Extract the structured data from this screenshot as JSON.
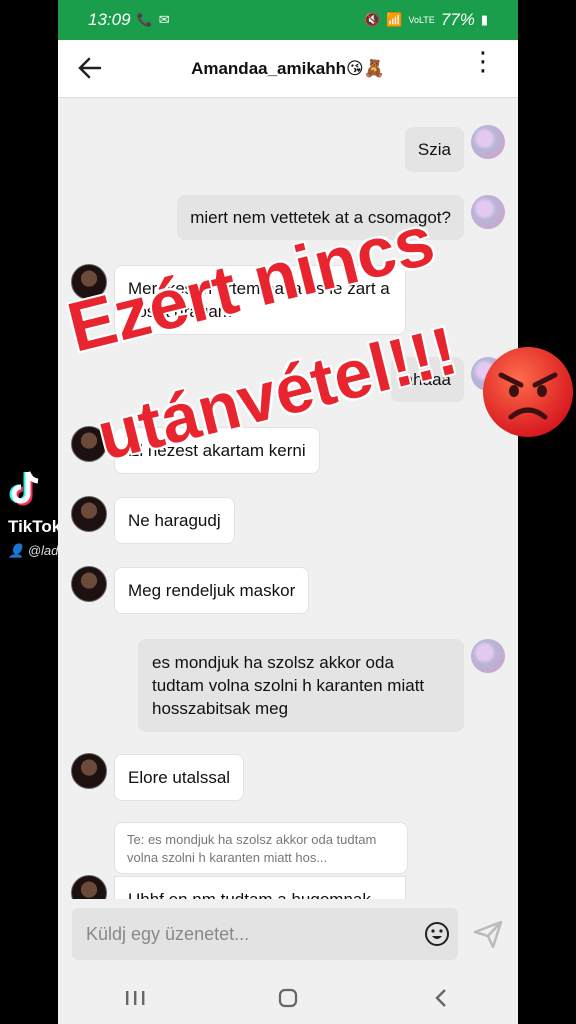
{
  "status_bar": {
    "time": "13:09",
    "battery": "77%",
    "network": "VoLTE"
  },
  "header": {
    "title": "Amandaa_amikahh😘🧸"
  },
  "messages": [
    {
      "side": "out",
      "text": "Szia"
    },
    {
      "side": "out",
      "text": "miert nem vettetek at a csomagot?"
    },
    {
      "side": "in",
      "text": "Mert keson ertem haza es le zart a posta dragam"
    },
    {
      "side": "out",
      "text": "ahaaa"
    },
    {
      "side": "in",
      "text": "El nezest akartam kerni"
    },
    {
      "side": "in",
      "text": "Ne haragudj"
    },
    {
      "side": "in",
      "text": "Meg rendeljuk maskor"
    },
    {
      "side": "out",
      "text": "es mondjuk ha szolsz akkor oda tudtam volna szolni h karanten miatt hosszabitsak meg"
    },
    {
      "side": "in",
      "text": "Elore utalssal"
    },
    {
      "side": "in",
      "text": "Uhhf en nm tudtam a hugomnak"
    }
  ],
  "reply_preview": {
    "text": "Te: es mondjuk ha szolsz akkor oda tudtam volna szolni h karanten miatt hos..."
  },
  "composer": {
    "placeholder": "Küldj egy üzenetet..."
  },
  "overlay": {
    "line1": "Ezért nincs",
    "line2": "utánvétel!!!"
  },
  "watermark": {
    "brand": "TikTok",
    "user": "@lad"
  },
  "colors": {
    "status_bar": "#1a9e4b",
    "overlay_text": "#e8242e",
    "incoming_bubble": "#ffffff",
    "outgoing_bubble": "#e4e4e4"
  }
}
